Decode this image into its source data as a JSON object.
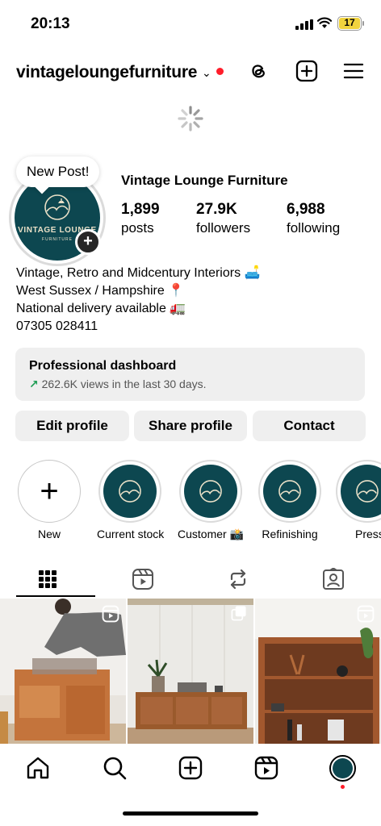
{
  "status_bar": {
    "time": "20:13",
    "battery": "17"
  },
  "header": {
    "username": "vintageloungefurniture"
  },
  "profile": {
    "bubble": "New Post!",
    "avatar_brand": "VINTAGE LOUNGE",
    "avatar_sub": "FURNITURE",
    "name": "Vintage Lounge Furniture",
    "stats": [
      {
        "value": "1,899",
        "label": "posts"
      },
      {
        "value": "27.9K",
        "label": "followers"
      },
      {
        "value": "6,988",
        "label": "following"
      }
    ],
    "bio": [
      "Vintage, Retro and Midcentury Interiors 🛋️",
      "West Sussex / Hampshire 📍",
      "National delivery available 🚛",
      "07305 028411"
    ]
  },
  "dashboard": {
    "title": "Professional dashboard",
    "subtitle": "262.6K views in the last 30 days."
  },
  "buttons": {
    "edit": "Edit profile",
    "share": "Share profile",
    "contact": "Contact"
  },
  "highlights": [
    {
      "label": "New"
    },
    {
      "label": "Current stock"
    },
    {
      "label": "Customer 📸"
    },
    {
      "label": "Refinishing"
    },
    {
      "label": "Press"
    }
  ],
  "tabs": [
    "grid-icon",
    "reels-icon",
    "reposts-icon",
    "tagged-icon"
  ],
  "colors": {
    "accent_green": "#1f9e55",
    "brand_teal": "#0d4750",
    "notify_red": "#ff1d2a"
  }
}
